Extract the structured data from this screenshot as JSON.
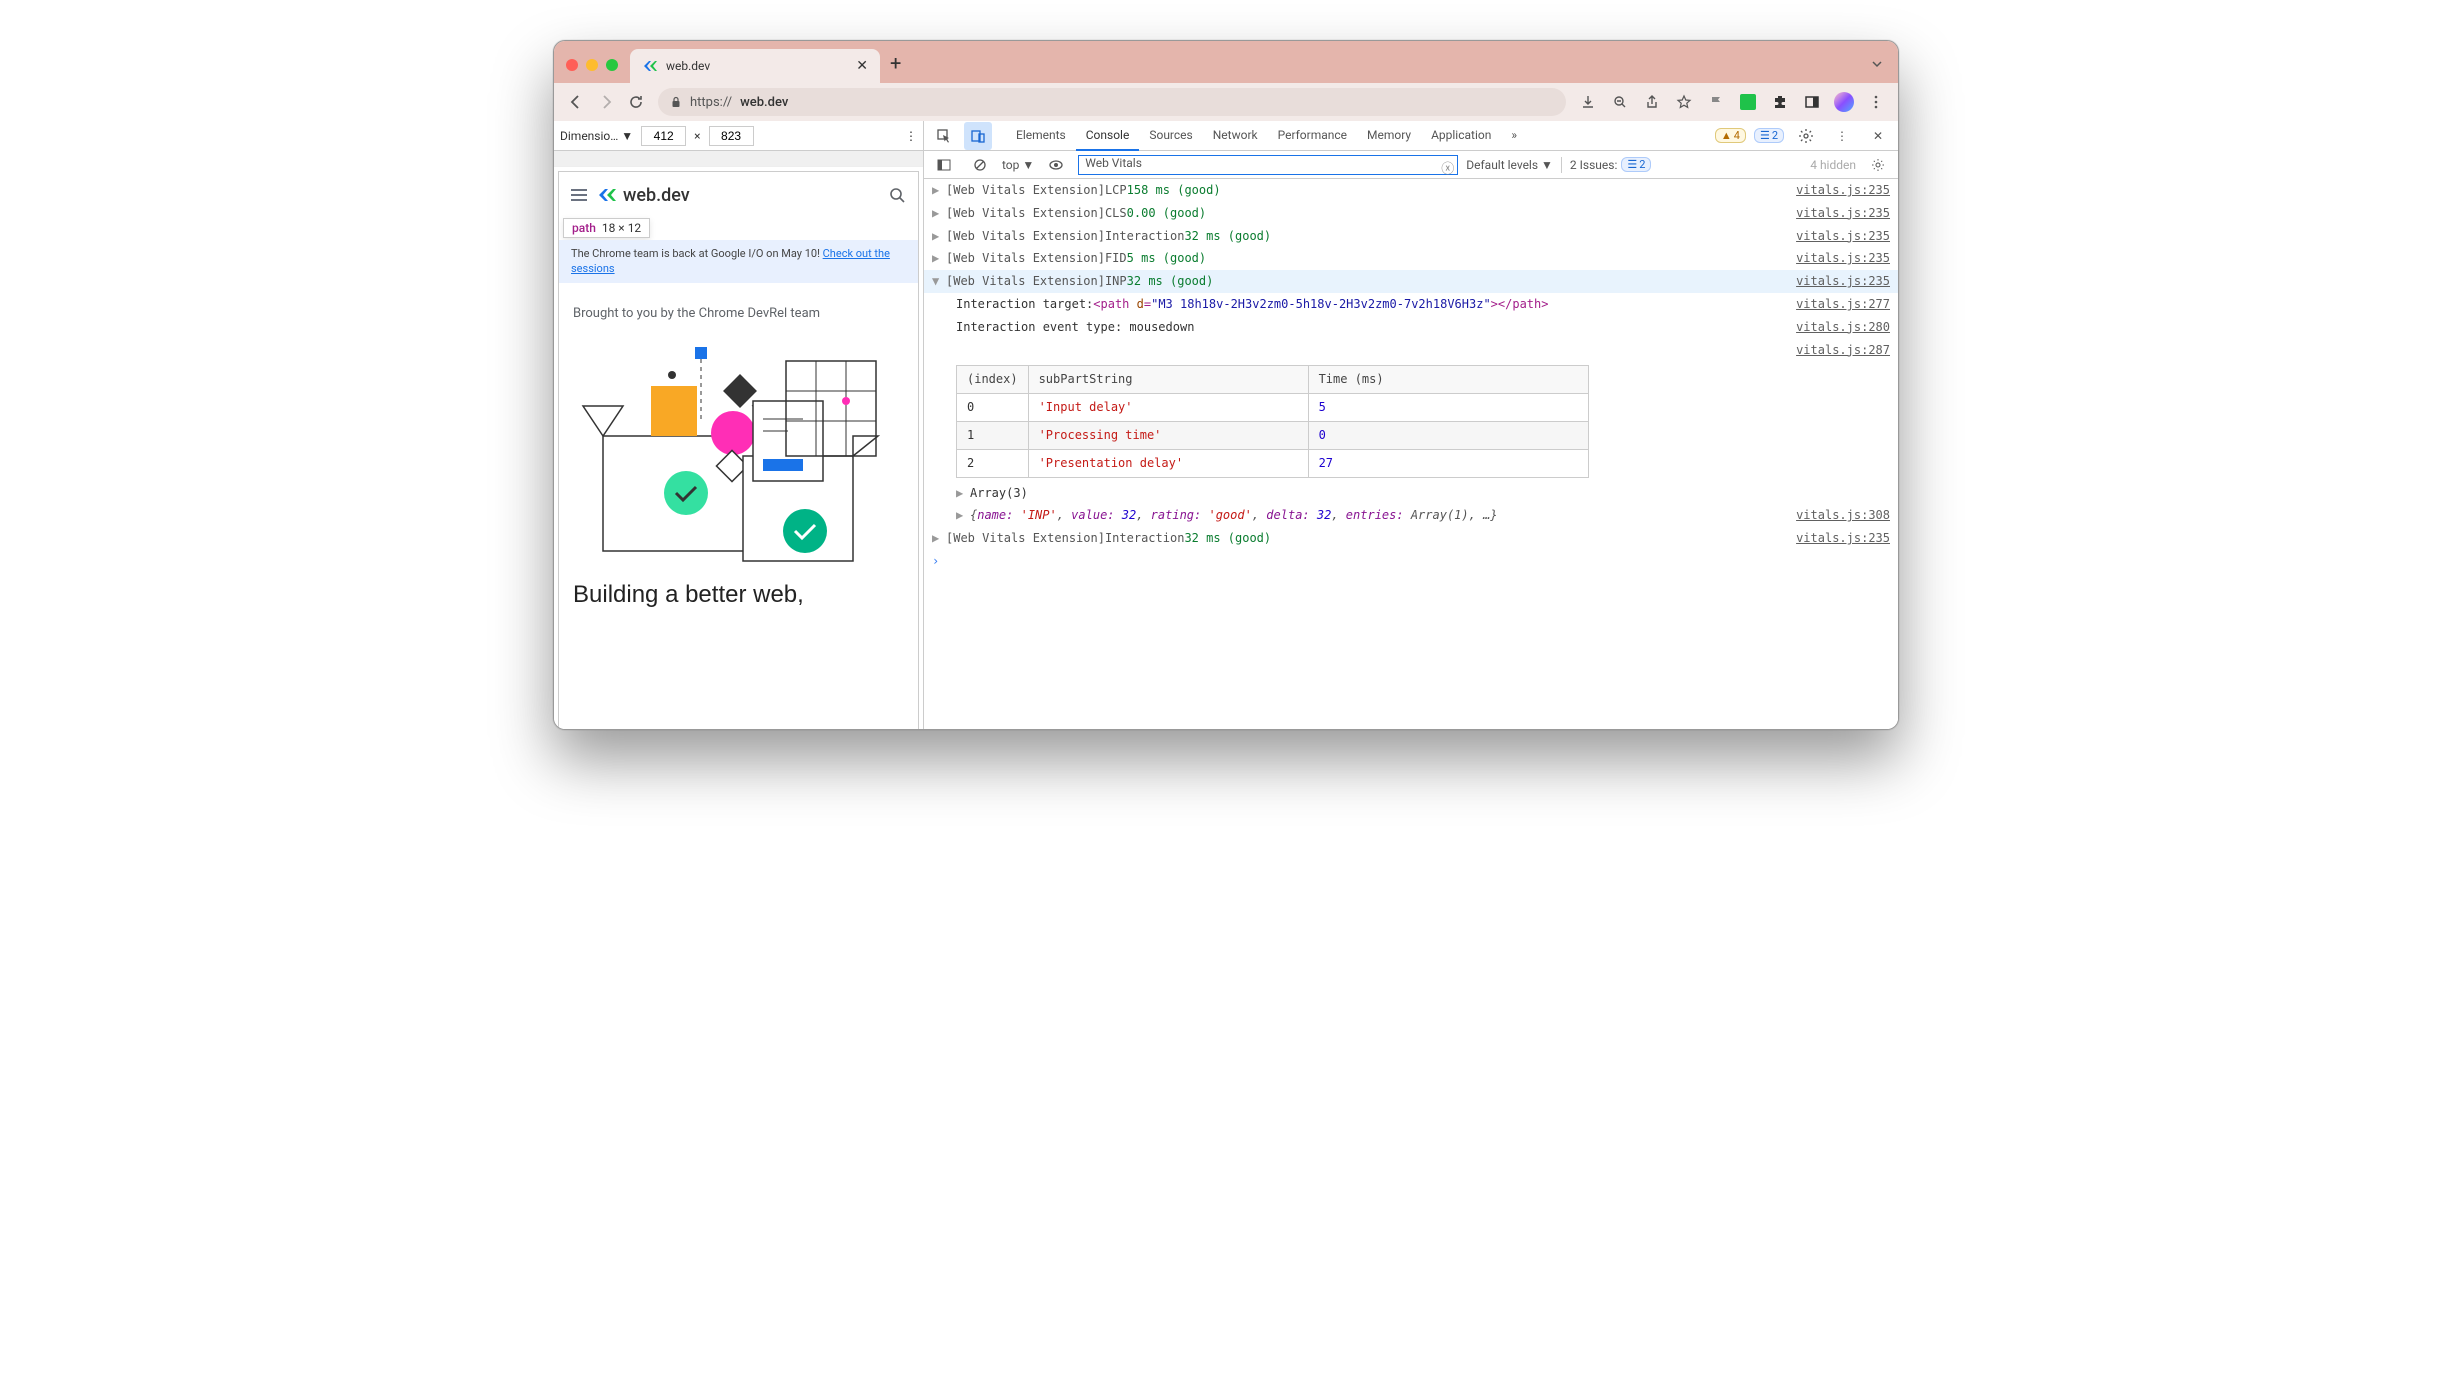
{
  "browser": {
    "tab_title": "web.dev",
    "url_prefix": "https://",
    "url_host": "web.dev"
  },
  "device_toolbar": {
    "label": "Dimensio…",
    "width": "412",
    "sep": "×",
    "height": "823"
  },
  "site": {
    "logo_text": "web.dev",
    "tooltip_element": "path",
    "tooltip_dims": "18 × 12",
    "banner_text": "The Chrome team is back at Google I/O on May 10! ",
    "banner_link": "Check out the sessions",
    "blurb": "Brought to you by the Chrome DevRel team",
    "headline": "Building a better web,"
  },
  "devtools": {
    "tabs": [
      "Elements",
      "Console",
      "Sources",
      "Network",
      "Performance",
      "Memory",
      "Application"
    ],
    "more_tabs_glyph": "»",
    "warn_count": "4",
    "info_count": "2",
    "console": {
      "context": "top",
      "filter_value": "Web Vitals",
      "levels_label": "Default levels",
      "issues_label": "2 Issues:",
      "issues_count": "2",
      "hidden_label": "4 hidden"
    }
  },
  "log": {
    "prefix": "[Web Vitals Extension]",
    "entries": [
      {
        "metric": "LCP",
        "value": "158 ms (good)",
        "src": "vitals.js:235",
        "expanded": false
      },
      {
        "metric": "CLS",
        "value": "0.00 (good)",
        "src": "vitals.js:235",
        "expanded": false
      },
      {
        "metric": "Interaction",
        "value": "32 ms (good)",
        "src": "vitals.js:235",
        "expanded": false
      },
      {
        "metric": "FID",
        "value": "5 ms (good)",
        "src": "vitals.js:235",
        "expanded": false
      }
    ],
    "inp": {
      "metric": "INP",
      "value": "32 ms (good)",
      "src": "vitals.js:235",
      "target_label": "Interaction target:",
      "target_html_open": "<path ",
      "target_html_attr": "d",
      "target_html_val": "\"M3 18h18v-2H3v2zm0-5h18v-2H3v2zm0-7v2h18V6H3z\"",
      "target_html_close": "></path>",
      "target_src": "vitals.js:277",
      "event_label": "Interaction event type: ",
      "event_value": "mousedown",
      "event_src": "vitals.js:280",
      "table_src": "vitals.js:287",
      "table_headers": [
        "(index)",
        "subPartString",
        "Time (ms)"
      ],
      "table_rows": [
        {
          "idx": "0",
          "part": "'Input delay'",
          "time": "5"
        },
        {
          "idx": "1",
          "part": "'Processing time'",
          "time": "0"
        },
        {
          "idx": "2",
          "part": "'Presentation delay'",
          "time": "27"
        }
      ],
      "array_caption": "Array(3)",
      "obj_line_prefix": "{",
      "obj_name_key": "name:",
      "obj_name_val": "'INP'",
      "obj_value_key": "value:",
      "obj_value_val": "32",
      "obj_rating_key": "rating:",
      "obj_rating_val": "'good'",
      "obj_delta_key": "delta:",
      "obj_delta_val": "32",
      "obj_entries_key": "entries:",
      "obj_entries_val": "Array(1)",
      "obj_suffix": ", …}",
      "obj_src": "vitals.js:308"
    },
    "trailing": {
      "metric": "Interaction",
      "value": "32 ms (good)",
      "src": "vitals.js:235"
    }
  }
}
